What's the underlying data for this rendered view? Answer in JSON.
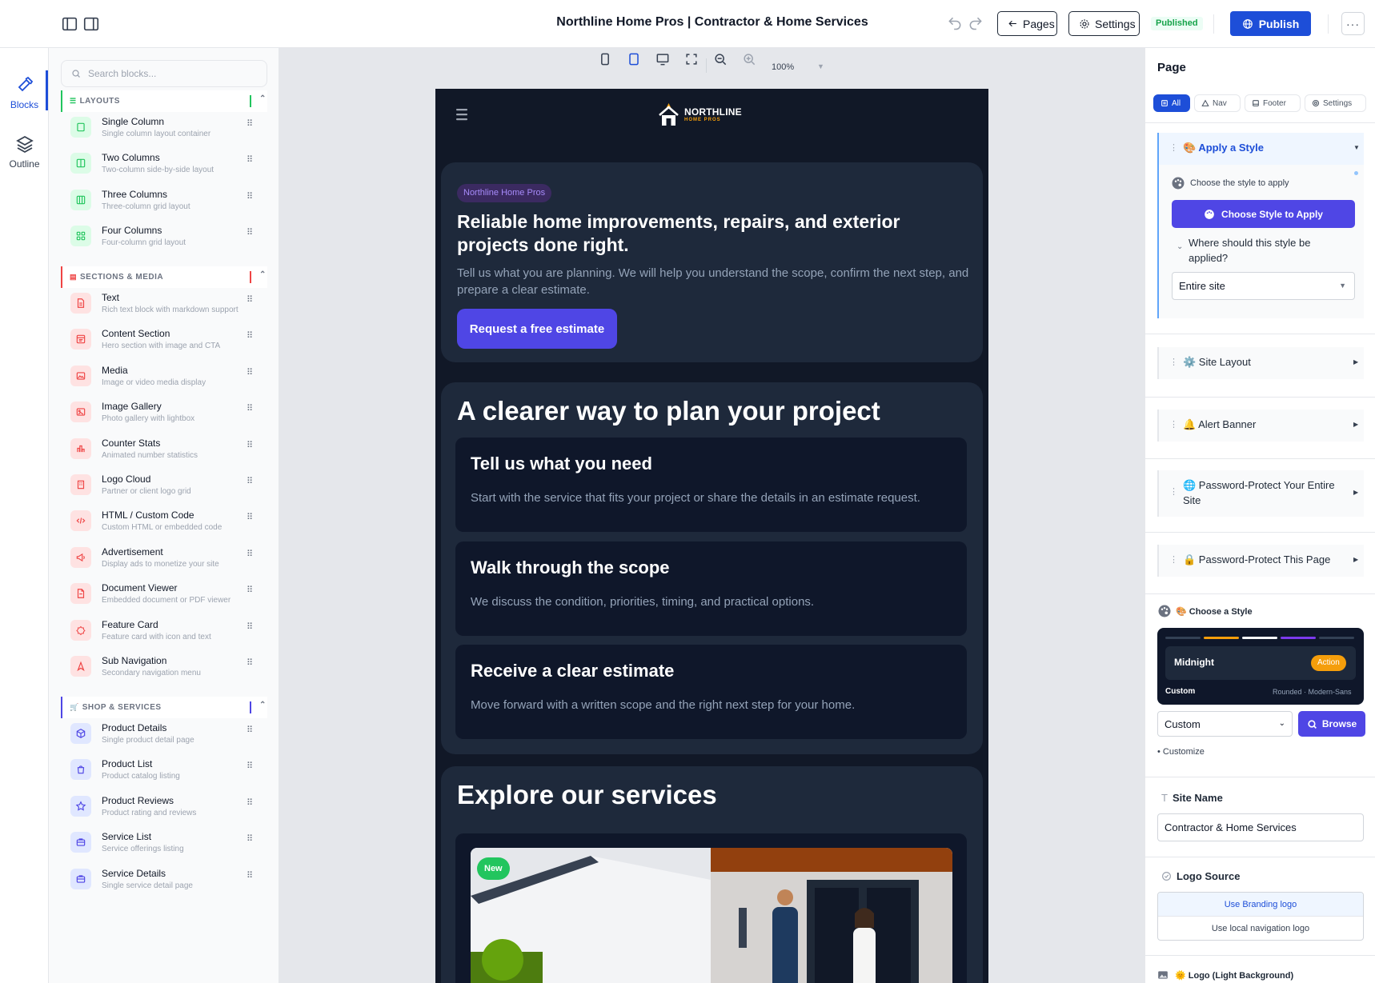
{
  "topbar": {
    "site_title": "Northline Home Pros | Contractor & Home Services",
    "pages_label": "Pages",
    "settings_label": "Settings",
    "status_badge": "Published",
    "publish_label": "Publish",
    "more_label": "···"
  },
  "rail": {
    "blocks_label": "Blocks",
    "outline_label": "Outline"
  },
  "blocks_panel": {
    "search_placeholder": "Search blocks...",
    "sections": [
      {
        "title": "LAYOUTS",
        "accent": "#22c55e",
        "items": [
          {
            "name": "Single Column",
            "desc": "Single column layout container",
            "icon": "column-icon"
          },
          {
            "name": "Two Columns",
            "desc": "Two-column side-by-side layout",
            "icon": "columns-icon"
          },
          {
            "name": "Three Columns",
            "desc": "Three-column grid layout",
            "icon": "columns-3-icon"
          },
          {
            "name": "Four Columns",
            "desc": "Four-column grid layout",
            "icon": "grid-icon"
          }
        ]
      },
      {
        "title": "SECTIONS & MEDIA",
        "accent": "#ef4444",
        "items": [
          {
            "name": "Text",
            "desc": "Rich text block with markdown support",
            "icon": "file-text-icon"
          },
          {
            "name": "Content Section",
            "desc": "Hero section with image and CTA",
            "icon": "layout-icon"
          },
          {
            "name": "Media",
            "desc": "Image or video media display",
            "icon": "image-icon"
          },
          {
            "name": "Image Gallery",
            "desc": "Photo gallery with lightbox",
            "icon": "gallery-icon"
          },
          {
            "name": "Counter Stats",
            "desc": "Animated number statistics",
            "icon": "stats-icon"
          },
          {
            "name": "Logo Cloud",
            "desc": "Partner or client logo grid",
            "icon": "building-icon"
          },
          {
            "name": "HTML / Custom Code",
            "desc": "Custom HTML or embedded code",
            "icon": "code-icon"
          },
          {
            "name": "Advertisement",
            "desc": "Display ads to monetize your site",
            "icon": "megaphone-icon"
          },
          {
            "name": "Document Viewer",
            "desc": "Embedded document or PDF viewer",
            "icon": "document-icon"
          },
          {
            "name": "Feature Card",
            "desc": "Feature card with icon and text",
            "icon": "badge-icon"
          },
          {
            "name": "Sub Navigation",
            "desc": "Secondary navigation menu",
            "icon": "nav-icon"
          }
        ]
      },
      {
        "title": "SHOP & SERVICES",
        "accent": "#4f46e5",
        "items": [
          {
            "name": "Product Details",
            "desc": "Single product detail page",
            "icon": "box-icon"
          },
          {
            "name": "Product List",
            "desc": "Product catalog listing",
            "icon": "shopping-bag-icon"
          },
          {
            "name": "Product Reviews",
            "desc": "Product rating and reviews",
            "icon": "star-icon"
          },
          {
            "name": "Service List",
            "desc": "Service offerings listing",
            "icon": "briefcase-icon"
          },
          {
            "name": "Service Details",
            "desc": "Single service detail page",
            "icon": "briefcase-icon"
          }
        ]
      }
    ]
  },
  "canvas": {
    "zoom": "100%",
    "preview": {
      "logo_title": "NORTHLINE",
      "logo_subtitle": "HOME PROS",
      "hero": {
        "badge": "Northline Home Pros",
        "heading": "Reliable home improvements, repairs, and exterior projects done right.",
        "body": "Tell us what you are planning. We will help you understand the scope, confirm the next step, and prepare a clear estimate.",
        "cta": "Request a free estimate"
      },
      "steps_heading": "A clearer way to plan your project",
      "steps": [
        {
          "title": "Tell us what you need",
          "body": "Start with the service that fits your project or share the details in an estimate request."
        },
        {
          "title": "Walk through the scope",
          "body": "We discuss the condition, priorities, timing, and practical options."
        },
        {
          "title": "Receive a clear estimate",
          "body": "Move forward with a written scope and the right next step for your home."
        }
      ],
      "services_heading": "Explore our services",
      "service_badge": "New"
    }
  },
  "page_panel": {
    "title": "Page",
    "tabs": [
      {
        "label": "All",
        "active": true
      },
      {
        "label": "Nav",
        "active": false
      },
      {
        "label": "Footer",
        "active": false
      },
      {
        "label": "Settings",
        "active": false
      }
    ],
    "apply_style": {
      "title": "🎨 Apply a Style",
      "choose_label": "Choose the style to apply",
      "choose_button": "Choose Style to Apply",
      "where_label": "Where should this style be applied?",
      "where_value": "Entire site"
    },
    "collapsed": [
      "⚙️ Site Layout",
      "🔔 Alert Banner",
      "🌐 Password-Protect Your Entire Site",
      "🔒 Password-Protect This Page"
    ],
    "choose_style": {
      "label": "🎨 Choose a Style",
      "preview_name": "Midnight",
      "preview_action": "Action",
      "preview_kind": "Custom",
      "preview_meta": "Rounded · Modern-Sans",
      "select_value": "Custom",
      "browse_label": "Browse",
      "customize_label": "• Customize"
    },
    "site_name": {
      "label": "Site Name",
      "value": "Contractor & Home Services"
    },
    "logo_source": {
      "label": "Logo Source",
      "option_1": "Use Branding logo",
      "option_2": "Use local navigation logo"
    },
    "logo_light_label": "🌞 Logo (Light Background)"
  },
  "colors": {
    "accent_blue": "#1d4ed8",
    "accent_purple": "#4f46e5",
    "preview_bg": "#111827",
    "preview_card": "#1e293b",
    "published_green": "#16a34a"
  }
}
